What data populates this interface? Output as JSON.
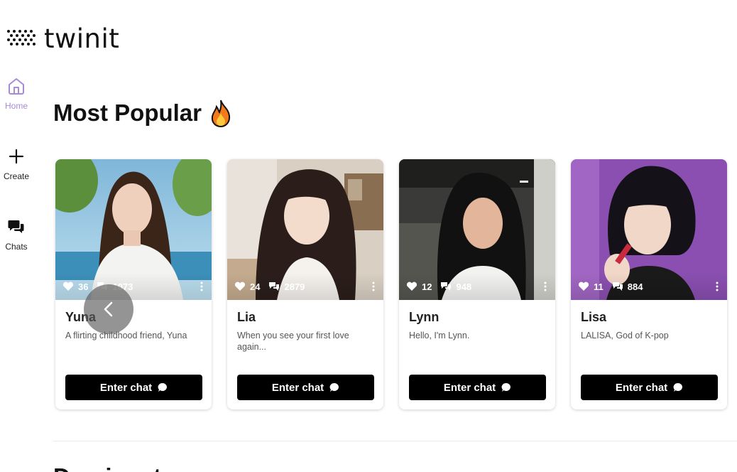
{
  "brand": {
    "name": "twinit"
  },
  "nav": {
    "items": [
      {
        "label": "Home",
        "icon": "home-icon",
        "active": true
      },
      {
        "label": "Create",
        "icon": "plus-icon",
        "active": false
      },
      {
        "label": "Chats",
        "icon": "chat-bubbles-icon",
        "active": false
      }
    ],
    "active_color": "#a78bd8"
  },
  "sections": {
    "popular": {
      "title": "Most Popular",
      "emoji_icon": "fire-icon"
    },
    "next": {
      "title": "Dominant"
    }
  },
  "cards": [
    {
      "name": "Yuna",
      "likes": "36",
      "chats": "1073",
      "description": "A flirting childhood friend, Yuna",
      "button": "Enter chat"
    },
    {
      "name": "Lia",
      "likes": "24",
      "chats": "2879",
      "description": "When you see your first love again...",
      "button": "Enter chat"
    },
    {
      "name": "Lynn",
      "likes": "12",
      "chats": "948",
      "description": "Hello, I'm Lynn.",
      "button": "Enter chat"
    },
    {
      "name": "Lisa",
      "likes": "11",
      "chats": "884",
      "description": "LALISA, God of K-pop",
      "button": "Enter chat"
    }
  ],
  "carousel": {
    "prev_icon": "chevron-left-icon"
  }
}
